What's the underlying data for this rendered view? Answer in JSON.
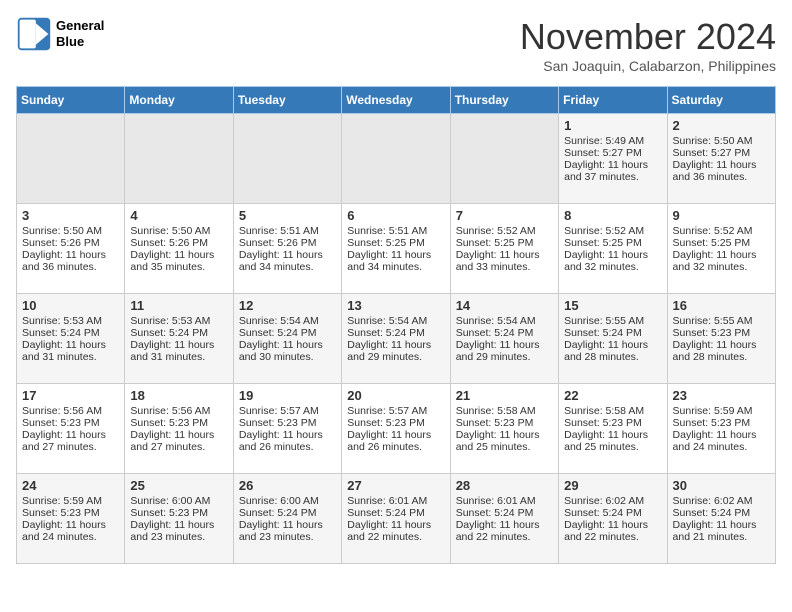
{
  "header": {
    "logo_line1": "General",
    "logo_line2": "Blue",
    "month": "November 2024",
    "location": "San Joaquin, Calabarzon, Philippines"
  },
  "weekdays": [
    "Sunday",
    "Monday",
    "Tuesday",
    "Wednesday",
    "Thursday",
    "Friday",
    "Saturday"
  ],
  "weeks": [
    [
      {
        "day": "",
        "empty": true
      },
      {
        "day": "",
        "empty": true
      },
      {
        "day": "",
        "empty": true
      },
      {
        "day": "",
        "empty": true
      },
      {
        "day": "",
        "empty": true
      },
      {
        "day": "1",
        "sunrise": "5:49 AM",
        "sunset": "5:27 PM",
        "daylight": "11 hours and 37 minutes."
      },
      {
        "day": "2",
        "sunrise": "5:50 AM",
        "sunset": "5:27 PM",
        "daylight": "11 hours and 36 minutes."
      }
    ],
    [
      {
        "day": "3",
        "sunrise": "5:50 AM",
        "sunset": "5:26 PM",
        "daylight": "11 hours and 36 minutes."
      },
      {
        "day": "4",
        "sunrise": "5:50 AM",
        "sunset": "5:26 PM",
        "daylight": "11 hours and 35 minutes."
      },
      {
        "day": "5",
        "sunrise": "5:51 AM",
        "sunset": "5:26 PM",
        "daylight": "11 hours and 34 minutes."
      },
      {
        "day": "6",
        "sunrise": "5:51 AM",
        "sunset": "5:25 PM",
        "daylight": "11 hours and 34 minutes."
      },
      {
        "day": "7",
        "sunrise": "5:52 AM",
        "sunset": "5:25 PM",
        "daylight": "11 hours and 33 minutes."
      },
      {
        "day": "8",
        "sunrise": "5:52 AM",
        "sunset": "5:25 PM",
        "daylight": "11 hours and 32 minutes."
      },
      {
        "day": "9",
        "sunrise": "5:52 AM",
        "sunset": "5:25 PM",
        "daylight": "11 hours and 32 minutes."
      }
    ],
    [
      {
        "day": "10",
        "sunrise": "5:53 AM",
        "sunset": "5:24 PM",
        "daylight": "11 hours and 31 minutes."
      },
      {
        "day": "11",
        "sunrise": "5:53 AM",
        "sunset": "5:24 PM",
        "daylight": "11 hours and 31 minutes."
      },
      {
        "day": "12",
        "sunrise": "5:54 AM",
        "sunset": "5:24 PM",
        "daylight": "11 hours and 30 minutes."
      },
      {
        "day": "13",
        "sunrise": "5:54 AM",
        "sunset": "5:24 PM",
        "daylight": "11 hours and 29 minutes."
      },
      {
        "day": "14",
        "sunrise": "5:54 AM",
        "sunset": "5:24 PM",
        "daylight": "11 hours and 29 minutes."
      },
      {
        "day": "15",
        "sunrise": "5:55 AM",
        "sunset": "5:24 PM",
        "daylight": "11 hours and 28 minutes."
      },
      {
        "day": "16",
        "sunrise": "5:55 AM",
        "sunset": "5:23 PM",
        "daylight": "11 hours and 28 minutes."
      }
    ],
    [
      {
        "day": "17",
        "sunrise": "5:56 AM",
        "sunset": "5:23 PM",
        "daylight": "11 hours and 27 minutes."
      },
      {
        "day": "18",
        "sunrise": "5:56 AM",
        "sunset": "5:23 PM",
        "daylight": "11 hours and 27 minutes."
      },
      {
        "day": "19",
        "sunrise": "5:57 AM",
        "sunset": "5:23 PM",
        "daylight": "11 hours and 26 minutes."
      },
      {
        "day": "20",
        "sunrise": "5:57 AM",
        "sunset": "5:23 PM",
        "daylight": "11 hours and 26 minutes."
      },
      {
        "day": "21",
        "sunrise": "5:58 AM",
        "sunset": "5:23 PM",
        "daylight": "11 hours and 25 minutes."
      },
      {
        "day": "22",
        "sunrise": "5:58 AM",
        "sunset": "5:23 PM",
        "daylight": "11 hours and 25 minutes."
      },
      {
        "day": "23",
        "sunrise": "5:59 AM",
        "sunset": "5:23 PM",
        "daylight": "11 hours and 24 minutes."
      }
    ],
    [
      {
        "day": "24",
        "sunrise": "5:59 AM",
        "sunset": "5:23 PM",
        "daylight": "11 hours and 24 minutes."
      },
      {
        "day": "25",
        "sunrise": "6:00 AM",
        "sunset": "5:23 PM",
        "daylight": "11 hours and 23 minutes."
      },
      {
        "day": "26",
        "sunrise": "6:00 AM",
        "sunset": "5:24 PM",
        "daylight": "11 hours and 23 minutes."
      },
      {
        "day": "27",
        "sunrise": "6:01 AM",
        "sunset": "5:24 PM",
        "daylight": "11 hours and 22 minutes."
      },
      {
        "day": "28",
        "sunrise": "6:01 AM",
        "sunset": "5:24 PM",
        "daylight": "11 hours and 22 minutes."
      },
      {
        "day": "29",
        "sunrise": "6:02 AM",
        "sunset": "5:24 PM",
        "daylight": "11 hours and 22 minutes."
      },
      {
        "day": "30",
        "sunrise": "6:02 AM",
        "sunset": "5:24 PM",
        "daylight": "11 hours and 21 minutes."
      }
    ]
  ]
}
